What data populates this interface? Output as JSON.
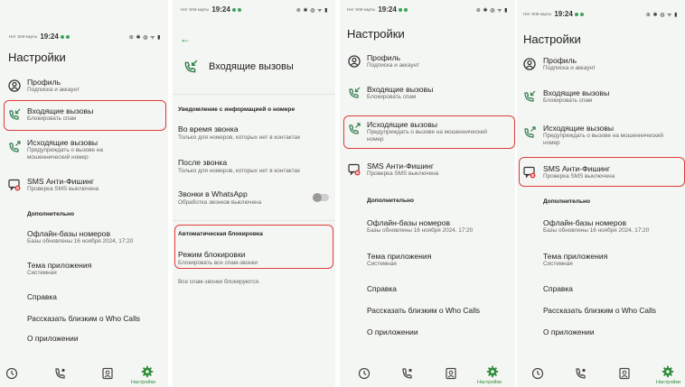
{
  "status": {
    "carrier": "Нет SIM-карты",
    "time": "19:24",
    "icons": "⊛ ✱ ◍ ᯤ ▮",
    "battery": "97"
  },
  "settings": {
    "title": "Настройки",
    "profile": {
      "title": "Профиль",
      "subtitle": "Подписка и аккаунт"
    },
    "incoming": {
      "title": "Входящие вызовы",
      "subtitle": "Блокировать спам"
    },
    "outgoing": {
      "title": "Исходящие вызовы",
      "subtitle": "Предупреждать о вызове на мошеннический номер"
    },
    "sms": {
      "title": "SMS Анти-Фишинг",
      "subtitle": "Проверка SMS выключена"
    },
    "advanced": "Дополнительно",
    "offline": {
      "title": "Офлайн-базы номеров",
      "subtitle": "Базы обновлены 16 ноября 2024, 17:20"
    },
    "theme": {
      "title": "Тема приложения",
      "subtitle": "Системная"
    },
    "help": "Справка",
    "share": "Рассказать близким о Who Calls",
    "about": "О приложении",
    "nav_settings": "Настройки"
  },
  "incoming_screen": {
    "title": "Входящие вызовы",
    "notify_section": "Уведомление с информацией о номере",
    "during": {
      "title": "Во время звонка",
      "subtitle": "Только для номеров, которых нет в контактах"
    },
    "after": {
      "title": "После звонка",
      "subtitle": "Только для номеров, которых нет в контактах"
    },
    "whatsapp": {
      "title": "Звонки в WhatsApp",
      "subtitle": "Обработка звонков выключена"
    },
    "auto_section": "Автоматическая блокировка",
    "mode": {
      "title": "Режим блокировки",
      "subtitle": "Блокировать все спам-звонки"
    },
    "note": "Все спам-звонки блокируются."
  },
  "colors": {
    "highlight": "#e23b3b",
    "accent": "#2e8b3a",
    "icon": "#2f7d4a"
  }
}
